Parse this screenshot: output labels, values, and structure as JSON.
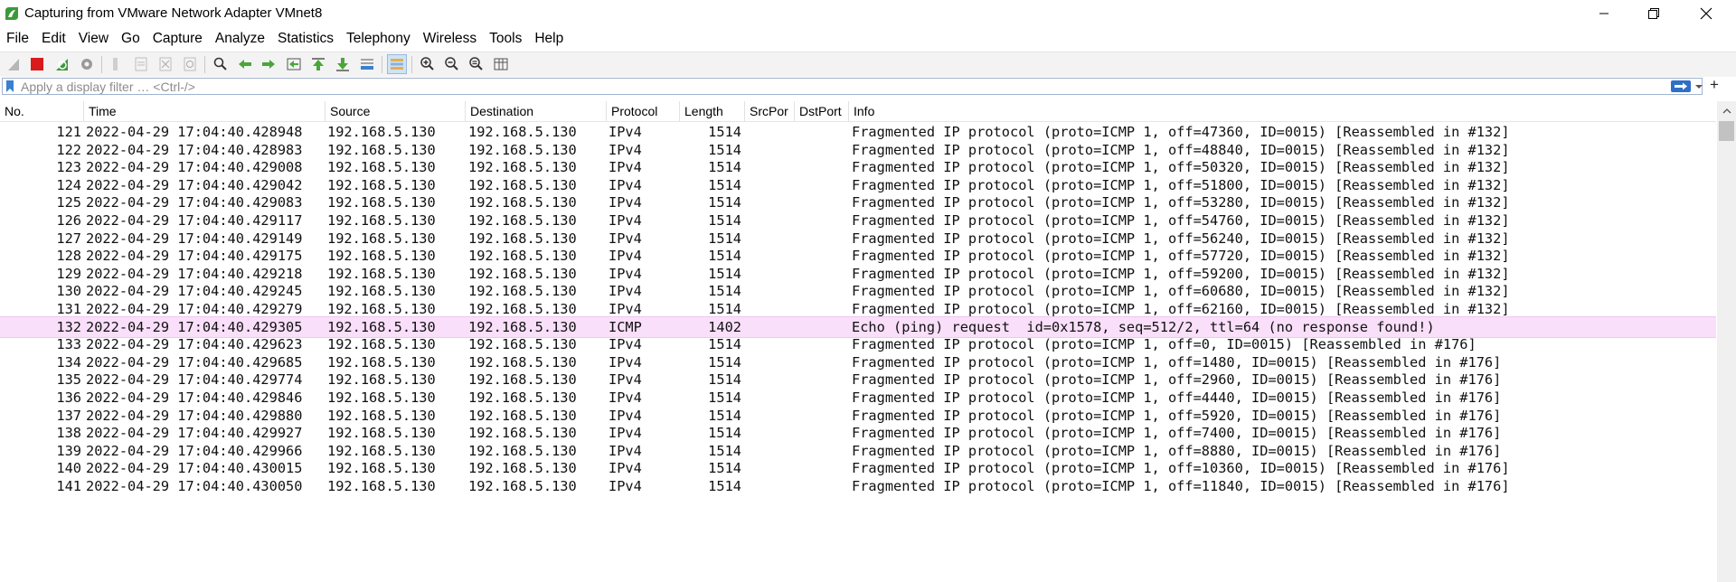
{
  "window": {
    "title": "Capturing from VMware Network Adapter VMnet8",
    "controls": [
      "minimize",
      "restore",
      "close"
    ]
  },
  "menu": [
    "File",
    "Edit",
    "View",
    "Go",
    "Capture",
    "Analyze",
    "Statistics",
    "Telephony",
    "Wireless",
    "Tools",
    "Help"
  ],
  "toolbar": {
    "icons": [
      "shark-fin-start-icon",
      "stop-square-icon",
      "restart-shark-fin-icon",
      "gear-options-icon",
      "open-file-icon",
      "save-file-icon",
      "close-file-icon",
      "reload-icon",
      "find-packet-icon",
      "go-back-icon",
      "go-forward-icon",
      "go-to-packet-icon",
      "go-first-icon",
      "go-last-icon",
      "autoscroll-icon",
      "colorize-icon",
      "zoom-in-icon",
      "zoom-out-icon",
      "zoom-normal-icon",
      "resize-columns-icon"
    ]
  },
  "filter": {
    "placeholder": "Apply a display filter … <Ctrl-/>",
    "value": ""
  },
  "columns": [
    "No.",
    "Time",
    "Source",
    "Destination",
    "Protocol",
    "Length",
    "SrcPor",
    "DstPort",
    "Info"
  ],
  "packets": [
    {
      "no": "121",
      "time": "2022-04-29 17:04:40.428948",
      "src": "192.168.5.130",
      "dst": "192.168.5.130",
      "proto": "IPv4",
      "len": "1514",
      "info": "Fragmented IP protocol (proto=ICMP 1, off=47360, ID=0015) [Reassembled in #132]"
    },
    {
      "no": "122",
      "time": "2022-04-29 17:04:40.428983",
      "src": "192.168.5.130",
      "dst": "192.168.5.130",
      "proto": "IPv4",
      "len": "1514",
      "info": "Fragmented IP protocol (proto=ICMP 1, off=48840, ID=0015) [Reassembled in #132]"
    },
    {
      "no": "123",
      "time": "2022-04-29 17:04:40.429008",
      "src": "192.168.5.130",
      "dst": "192.168.5.130",
      "proto": "IPv4",
      "len": "1514",
      "info": "Fragmented IP protocol (proto=ICMP 1, off=50320, ID=0015) [Reassembled in #132]"
    },
    {
      "no": "124",
      "time": "2022-04-29 17:04:40.429042",
      "src": "192.168.5.130",
      "dst": "192.168.5.130",
      "proto": "IPv4",
      "len": "1514",
      "info": "Fragmented IP protocol (proto=ICMP 1, off=51800, ID=0015) [Reassembled in #132]"
    },
    {
      "no": "125",
      "time": "2022-04-29 17:04:40.429083",
      "src": "192.168.5.130",
      "dst": "192.168.5.130",
      "proto": "IPv4",
      "len": "1514",
      "info": "Fragmented IP protocol (proto=ICMP 1, off=53280, ID=0015) [Reassembled in #132]"
    },
    {
      "no": "126",
      "time": "2022-04-29 17:04:40.429117",
      "src": "192.168.5.130",
      "dst": "192.168.5.130",
      "proto": "IPv4",
      "len": "1514",
      "info": "Fragmented IP protocol (proto=ICMP 1, off=54760, ID=0015) [Reassembled in #132]"
    },
    {
      "no": "127",
      "time": "2022-04-29 17:04:40.429149",
      "src": "192.168.5.130",
      "dst": "192.168.5.130",
      "proto": "IPv4",
      "len": "1514",
      "info": "Fragmented IP protocol (proto=ICMP 1, off=56240, ID=0015) [Reassembled in #132]"
    },
    {
      "no": "128",
      "time": "2022-04-29 17:04:40.429175",
      "src": "192.168.5.130",
      "dst": "192.168.5.130",
      "proto": "IPv4",
      "len": "1514",
      "info": "Fragmented IP protocol (proto=ICMP 1, off=57720, ID=0015) [Reassembled in #132]"
    },
    {
      "no": "129",
      "time": "2022-04-29 17:04:40.429218",
      "src": "192.168.5.130",
      "dst": "192.168.5.130",
      "proto": "IPv4",
      "len": "1514",
      "info": "Fragmented IP protocol (proto=ICMP 1, off=59200, ID=0015) [Reassembled in #132]"
    },
    {
      "no": "130",
      "time": "2022-04-29 17:04:40.429245",
      "src": "192.168.5.130",
      "dst": "192.168.5.130",
      "proto": "IPv4",
      "len": "1514",
      "info": "Fragmented IP protocol (proto=ICMP 1, off=60680, ID=0015) [Reassembled in #132]"
    },
    {
      "no": "131",
      "time": "2022-04-29 17:04:40.429279",
      "src": "192.168.5.130",
      "dst": "192.168.5.130",
      "proto": "IPv4",
      "len": "1514",
      "info": "Fragmented IP protocol (proto=ICMP 1, off=62160, ID=0015) [Reassembled in #132]"
    },
    {
      "no": "132",
      "time": "2022-04-29 17:04:40.429305",
      "src": "192.168.5.130",
      "dst": "192.168.5.130",
      "proto": "ICMP",
      "len": "1402",
      "info": "Echo (ping) request  id=0x1578, seq=512/2, ttl=64 (no response found!)",
      "selected": true
    },
    {
      "no": "133",
      "time": "2022-04-29 17:04:40.429623",
      "src": "192.168.5.130",
      "dst": "192.168.5.130",
      "proto": "IPv4",
      "len": "1514",
      "info": "Fragmented IP protocol (proto=ICMP 1, off=0, ID=0015) [Reassembled in #176]"
    },
    {
      "no": "134",
      "time": "2022-04-29 17:04:40.429685",
      "src": "192.168.5.130",
      "dst": "192.168.5.130",
      "proto": "IPv4",
      "len": "1514",
      "info": "Fragmented IP protocol (proto=ICMP 1, off=1480, ID=0015) [Reassembled in #176]"
    },
    {
      "no": "135",
      "time": "2022-04-29 17:04:40.429774",
      "src": "192.168.5.130",
      "dst": "192.168.5.130",
      "proto": "IPv4",
      "len": "1514",
      "info": "Fragmented IP protocol (proto=ICMP 1, off=2960, ID=0015) [Reassembled in #176]"
    },
    {
      "no": "136",
      "time": "2022-04-29 17:04:40.429846",
      "src": "192.168.5.130",
      "dst": "192.168.5.130",
      "proto": "IPv4",
      "len": "1514",
      "info": "Fragmented IP protocol (proto=ICMP 1, off=4440, ID=0015) [Reassembled in #176]"
    },
    {
      "no": "137",
      "time": "2022-04-29 17:04:40.429880",
      "src": "192.168.5.130",
      "dst": "192.168.5.130",
      "proto": "IPv4",
      "len": "1514",
      "info": "Fragmented IP protocol (proto=ICMP 1, off=5920, ID=0015) [Reassembled in #176]"
    },
    {
      "no": "138",
      "time": "2022-04-29 17:04:40.429927",
      "src": "192.168.5.130",
      "dst": "192.168.5.130",
      "proto": "IPv4",
      "len": "1514",
      "info": "Fragmented IP protocol (proto=ICMP 1, off=7400, ID=0015) [Reassembled in #176]"
    },
    {
      "no": "139",
      "time": "2022-04-29 17:04:40.429966",
      "src": "192.168.5.130",
      "dst": "192.168.5.130",
      "proto": "IPv4",
      "len": "1514",
      "info": "Fragmented IP protocol (proto=ICMP 1, off=8880, ID=0015) [Reassembled in #176]"
    },
    {
      "no": "140",
      "time": "2022-04-29 17:04:40.430015",
      "src": "192.168.5.130",
      "dst": "192.168.5.130",
      "proto": "IPv4",
      "len": "1514",
      "info": "Fragmented IP protocol (proto=ICMP 1, off=10360, ID=0015) [Reassembled in #176]"
    },
    {
      "no": "141",
      "time": "2022-04-29 17:04:40.430050",
      "src": "192.168.5.130",
      "dst": "192.168.5.130",
      "proto": "IPv4",
      "len": "1514",
      "info": "Fragmented IP protocol (proto=ICMP 1, off=11840, ID=0015) [Reassembled in #176]"
    }
  ],
  "colors": {
    "selected_row": "#fadffa",
    "toolbar_bg": "#f3f3f3",
    "stop_red": "#d81b1b",
    "shark_green": "#3a9a3a"
  }
}
